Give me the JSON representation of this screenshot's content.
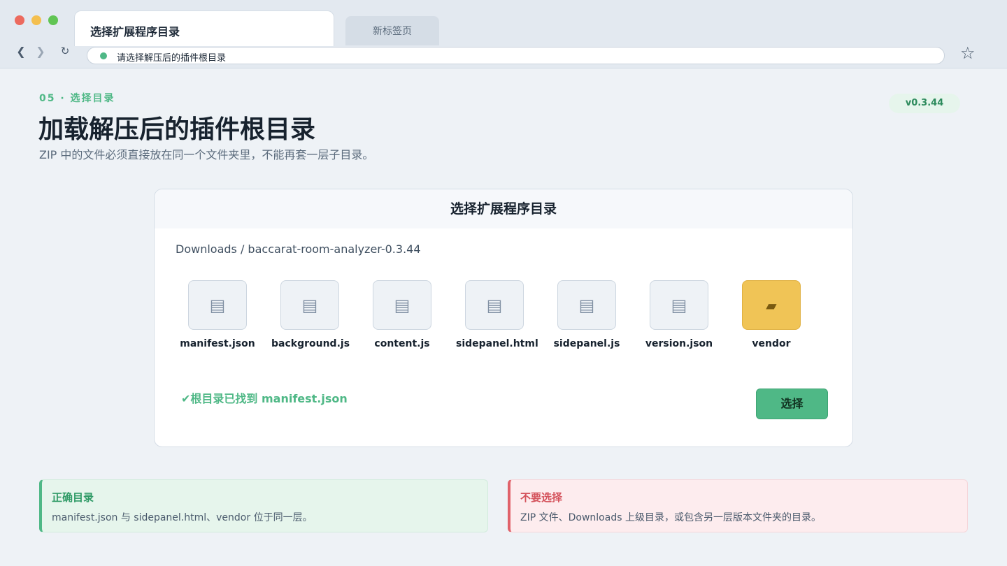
{
  "browser": {
    "active_tab": "选择扩展程序目录",
    "inactive_tab": "新标签页",
    "address": "请选择解压后的插件根目录",
    "nav": {
      "back": "❮",
      "forward": "❯",
      "reload": "↻",
      "star": "☆"
    }
  },
  "page": {
    "step": "05 · 选择目录",
    "title": "加载解压后的插件根目录",
    "subtitle": "ZIP 中的文件必须直接放在同一个文件夹里，不能再套一层子目录。",
    "version": "v0.3.44"
  },
  "dialog": {
    "title": "选择扩展程序目录",
    "path": "Downloads / baccarat-room-analyzer-0.3.44",
    "files": [
      {
        "name": "manifest.json",
        "glyph": "▤"
      },
      {
        "name": "background.js",
        "glyph": "▤"
      },
      {
        "name": "content.js",
        "glyph": "▤"
      },
      {
        "name": "sidepanel.html",
        "glyph": "▤"
      },
      {
        "name": "sidepanel.js",
        "glyph": "▤"
      },
      {
        "name": "version.json",
        "glyph": "▤"
      },
      {
        "name": "vendor",
        "glyph": "▰"
      }
    ],
    "status": "✔根目录已找到 manifest.json",
    "select_label": "选择"
  },
  "notes": {
    "ok": {
      "title": "正确目录",
      "text": "manifest.json 与 sidepanel.html、vendor 位于同一层。"
    },
    "bad": {
      "title": "不要选择",
      "text": "ZIP 文件、Downloads 上级目录，或包含另一层版本文件夹的目录。"
    }
  },
  "colors": {
    "accent": "#4fb886",
    "folder": "#f0c456",
    "danger": "#e0626a"
  },
  "icons": {
    "file": "file-icon",
    "folder": "folder-icon",
    "site_status": "status-dot-icon",
    "bookmark": "star-icon"
  }
}
